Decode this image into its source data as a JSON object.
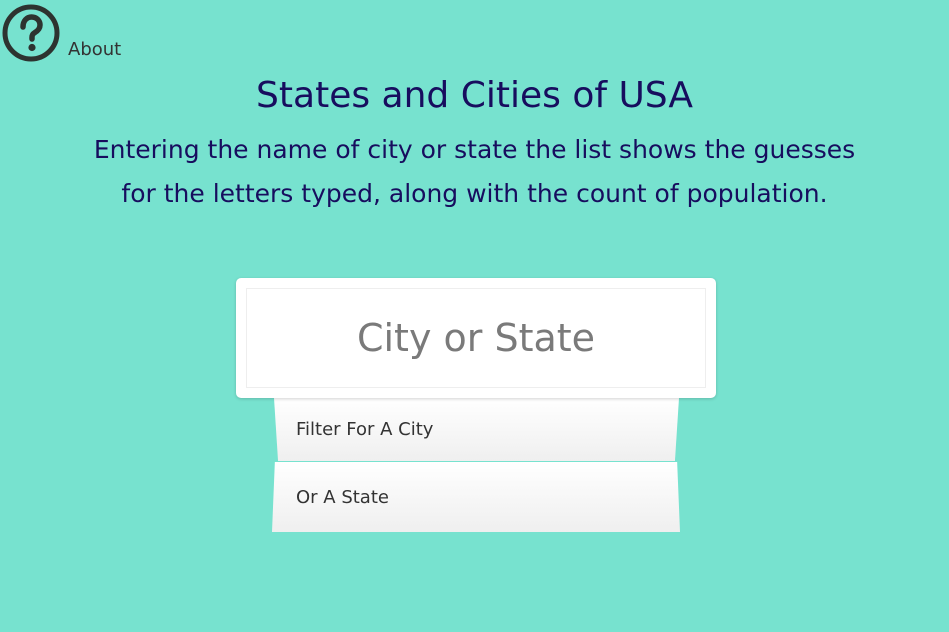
{
  "nav": {
    "about_label": "About",
    "about_icon": "help-circle-icon"
  },
  "header": {
    "title": "States and Cities of USA",
    "subtitle_line1": "Entering the name of city or state the list shows the guesses",
    "subtitle_line2": "for the letters typed, along with the count of population."
  },
  "search": {
    "placeholder": "City or State",
    "value": ""
  },
  "suggestions": [
    {
      "label": "Filter For A City"
    },
    {
      "label": "Or A State"
    }
  ],
  "colors": {
    "background": "#77e2cf",
    "heading": "#170d5e",
    "icon": "#333333",
    "placeholder": "#7a7a7a"
  }
}
